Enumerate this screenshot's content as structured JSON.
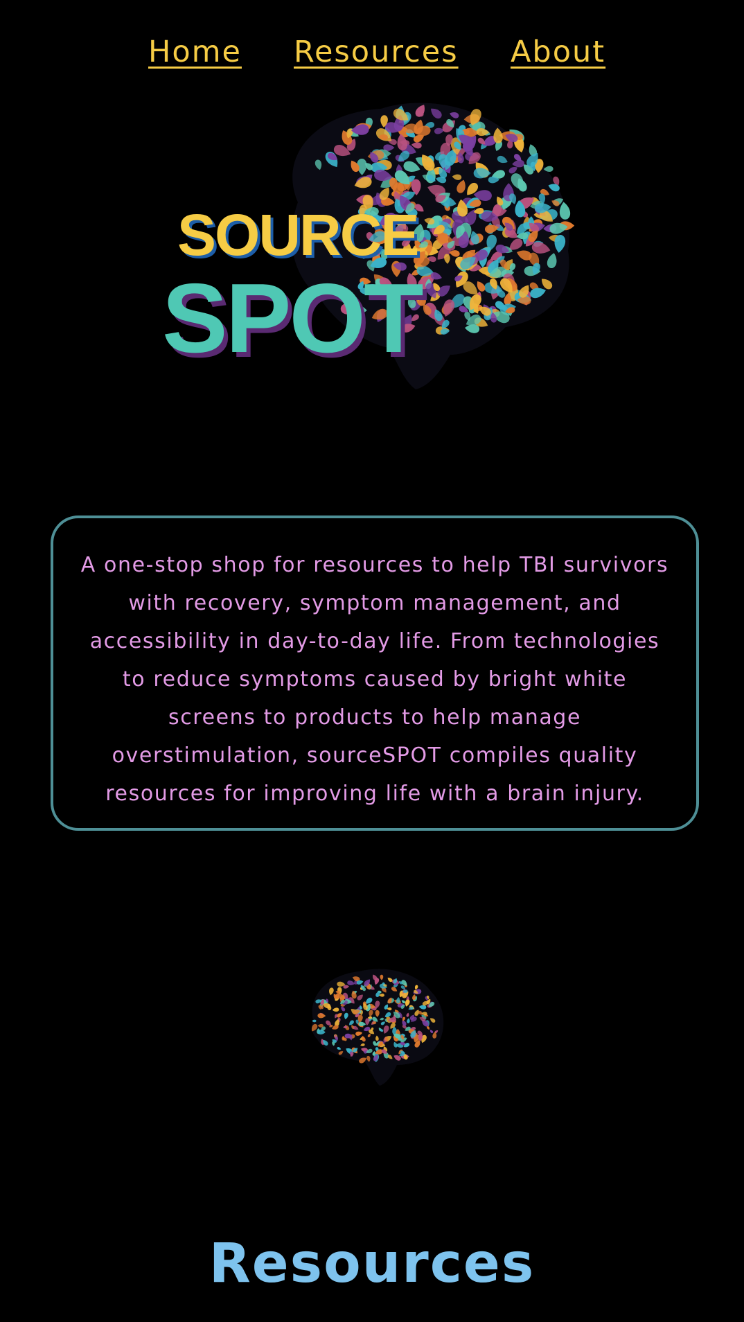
{
  "nav": {
    "home_label": "Home",
    "resources_label": "Resources",
    "about_label": "About"
  },
  "logo": {
    "word_top": "SOURCE",
    "word_bottom": "SPOT"
  },
  "mission": {
    "text": "A one-stop shop for resources to help TBI survivors with recovery, symptom management, and accessibility in day-to-day life. From technologies to reduce symptoms caused by bright white screens to products to help manage overstimulation, sourceSPOT compiles quality resources for improving life with a brain injury."
  },
  "section": {
    "title": "Resources"
  },
  "colors": {
    "background": "#000000",
    "nav_link": "#f6cc45",
    "logo_source": "#f6cc45",
    "logo_spot": "#4fc8b4",
    "logo_shadow": "#5a2a72",
    "mission_text": "#e39be6",
    "mission_border": "#4e8f96",
    "section_title": "#7ec3ee"
  },
  "icons": {
    "large_logo_art": "brain-icon",
    "small_logo_art": "small-brain-icon"
  }
}
